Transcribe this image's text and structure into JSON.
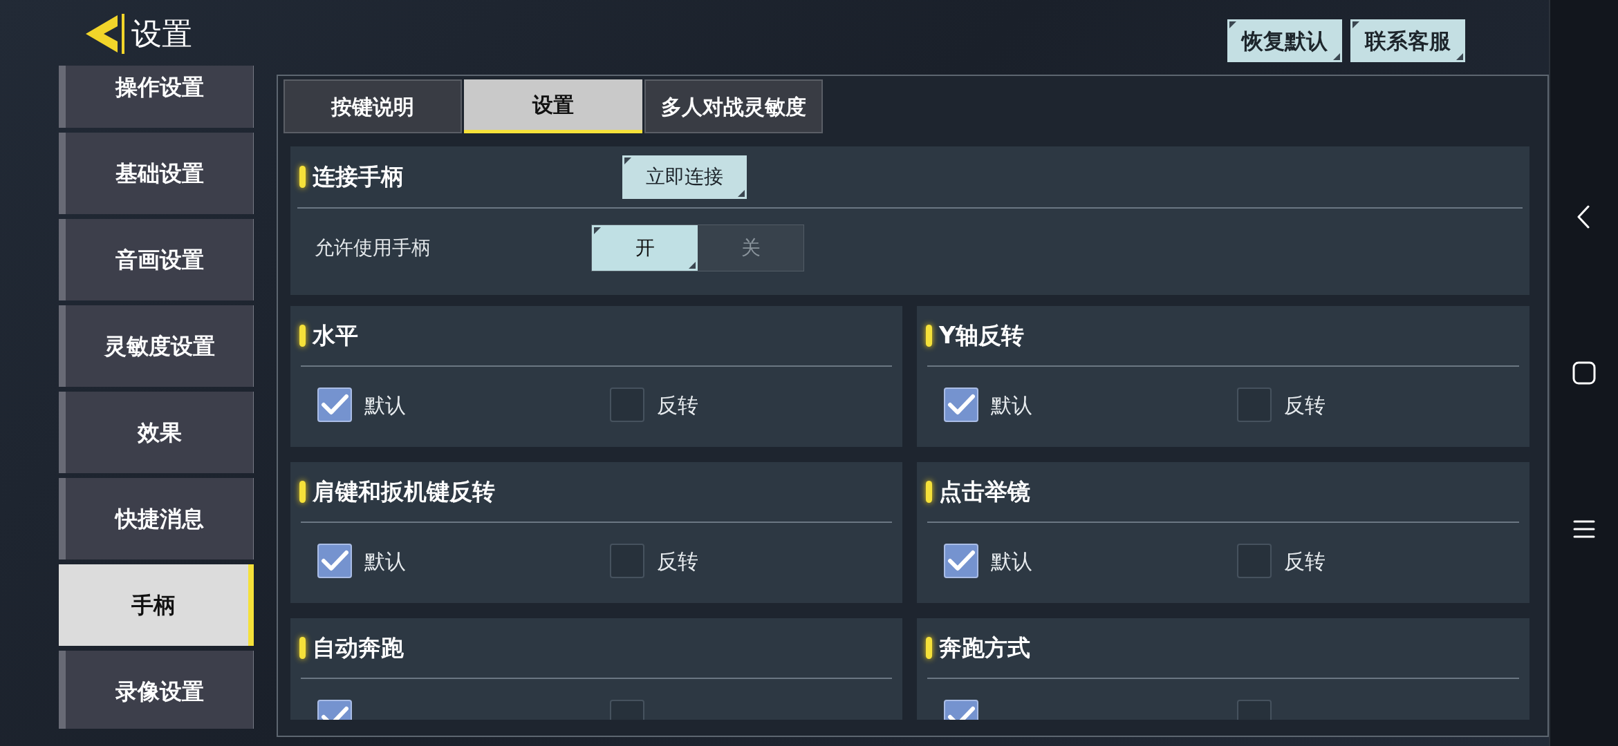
{
  "header": {
    "title": "设置"
  },
  "top_buttons": [
    "恢复默认",
    "联系客服"
  ],
  "sidebar": {
    "items": [
      {
        "label": "操作设置",
        "selected": false
      },
      {
        "label": "基础设置",
        "selected": false
      },
      {
        "label": "音画设置",
        "selected": false
      },
      {
        "label": "灵敏度设置",
        "selected": false
      },
      {
        "label": "效果",
        "selected": false
      },
      {
        "label": "快捷消息",
        "selected": false
      },
      {
        "label": "手柄",
        "selected": true
      },
      {
        "label": "录像设置",
        "selected": false
      }
    ]
  },
  "tabs": [
    {
      "label": "按键说明",
      "selected": false
    },
    {
      "label": "设置",
      "selected": true
    },
    {
      "label": "多人对战灵敏度",
      "selected": false
    }
  ],
  "connect_card": {
    "title": "连接手柄",
    "button": "立即连接",
    "setting": {
      "label": "允许使用手柄",
      "options": [
        {
          "label": "开",
          "selected": true
        },
        {
          "label": "关",
          "selected": false
        }
      ]
    }
  },
  "cards": [
    {
      "title": "水平",
      "options": [
        {
          "label": "默认",
          "checked": true
        },
        {
          "label": "反转",
          "checked": false
        }
      ]
    },
    {
      "title": "Y轴反转",
      "options": [
        {
          "label": "默认",
          "checked": true
        },
        {
          "label": "反转",
          "checked": false
        }
      ]
    },
    {
      "title": "肩键和扳机键反转",
      "options": [
        {
          "label": "默认",
          "checked": true
        },
        {
          "label": "反转",
          "checked": false
        }
      ]
    },
    {
      "title": "点击举镜",
      "options": [
        {
          "label": "默认",
          "checked": true
        },
        {
          "label": "反转",
          "checked": false
        }
      ]
    },
    {
      "title": "自动奔跑",
      "options": [
        {
          "checked": true
        },
        {
          "checked": false
        }
      ]
    },
    {
      "title": "奔跑方式",
      "options": [
        {
          "checked": true
        },
        {
          "checked": false
        }
      ]
    }
  ]
}
